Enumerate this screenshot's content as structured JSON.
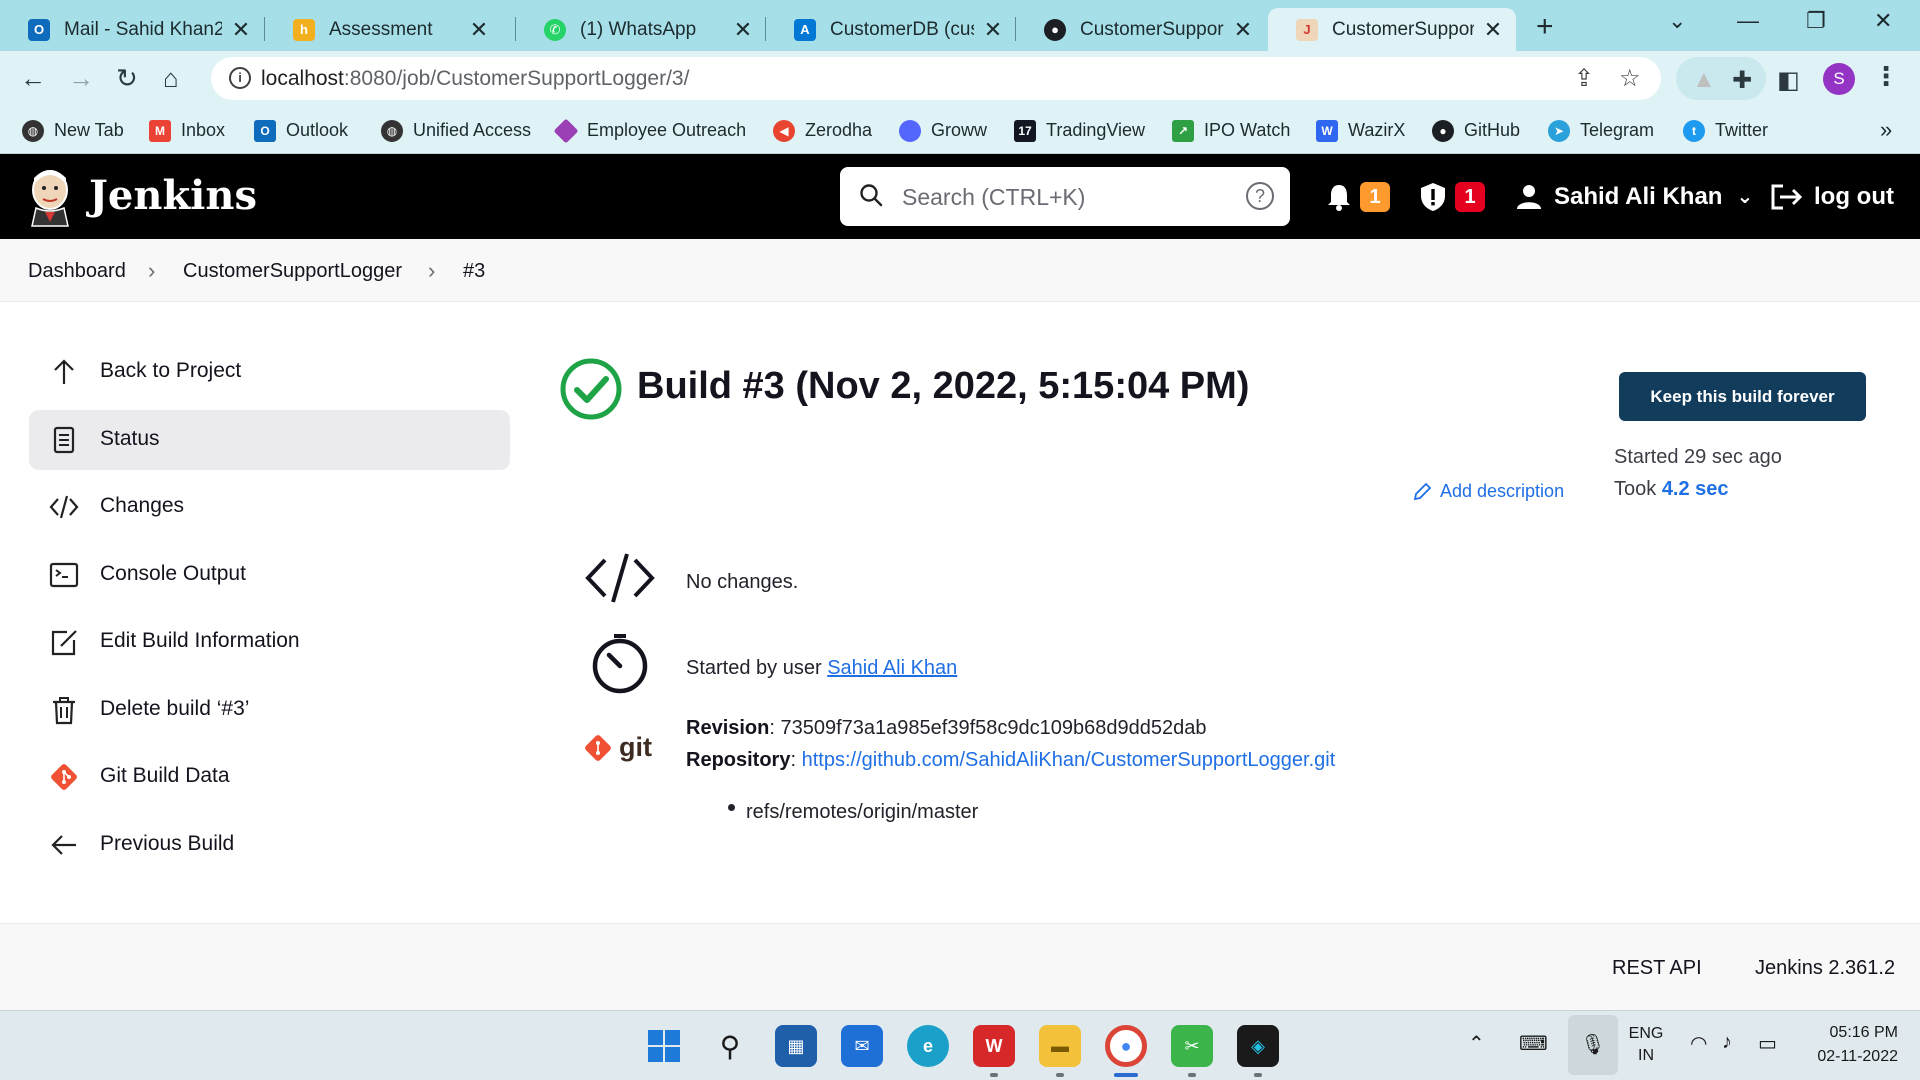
{
  "browser": {
    "tabs": [
      {
        "title": "Mail - Sahid Khan2",
        "icon": "outlook-icon",
        "color": "#0f6cbd"
      },
      {
        "title": "Assessment",
        "icon": "assessment-icon",
        "color": "#f2b01e"
      },
      {
        "title": "(1) WhatsApp",
        "icon": "whatsapp-icon",
        "color": "#25d366"
      },
      {
        "title": "CustomerDB (custo",
        "icon": "azure-icon",
        "color": "#0078d4"
      },
      {
        "title": "CustomerSupportLc",
        "icon": "github-icon",
        "color": "#1b1f23"
      },
      {
        "title": "CustomerSupportLc",
        "icon": "jenkins-icon",
        "color": "#d33833"
      }
    ],
    "url_scheme_host": "localhost",
    "url_rest": ":8080/job/CustomerSupportLogger/3/",
    "profile_initial": "S",
    "bookmarks": [
      {
        "label": "New Tab",
        "icon": "globe-icon",
        "color": "#333333"
      },
      {
        "label": "Inbox",
        "icon": "gmail-icon",
        "color": "#ea4335"
      },
      {
        "label": "Outlook",
        "icon": "outlook-icon",
        "color": "#0f6cbd"
      },
      {
        "label": "Unified Access",
        "icon": "globe-icon",
        "color": "#333333"
      },
      {
        "label": "Employee Outreach",
        "icon": "diamond-icon",
        "color": "#9b3fb5"
      },
      {
        "label": "Zerodha",
        "icon": "zerodha-icon",
        "color": "#e8442f"
      },
      {
        "label": "Groww",
        "icon": "groww-icon",
        "color": "#5367ff"
      },
      {
        "label": "TradingView",
        "icon": "tradingview-icon",
        "color": "#131722"
      },
      {
        "label": "IPO Watch",
        "icon": "chart-up-icon",
        "color": "#2ea043"
      },
      {
        "label": "WazirX",
        "icon": "wazirx-icon",
        "color": "#3067f0"
      },
      {
        "label": "GitHub",
        "icon": "github-icon",
        "color": "#1b1f23"
      },
      {
        "label": "Telegram",
        "icon": "telegram-icon",
        "color": "#2aa1da"
      },
      {
        "label": "Twitter",
        "icon": "twitter-icon",
        "color": "#1d9bf0"
      }
    ]
  },
  "jenkins": {
    "title": "Jenkins",
    "search_placeholder": "Search (CTRL+K)",
    "notifications_count": "1",
    "security_count": "1",
    "user_name": "Sahid Ali Khan",
    "logout_label": "log out",
    "breadcrumb": [
      "Dashboard",
      "CustomerSupportLogger",
      "#3"
    ],
    "side_panel": [
      {
        "label": "Back to Project",
        "icon": "arrow-up-icon",
        "active": false
      },
      {
        "label": "Status",
        "icon": "document-icon",
        "active": true
      },
      {
        "label": "Changes",
        "icon": "code-icon",
        "active": false
      },
      {
        "label": "Console Output",
        "icon": "terminal-icon",
        "active": false
      },
      {
        "label": "Edit Build Information",
        "icon": "edit-icon",
        "active": false
      },
      {
        "label": "Delete build ‘#3’",
        "icon": "trash-icon",
        "active": false
      },
      {
        "label": "Git Build Data",
        "icon": "git-icon",
        "active": false
      },
      {
        "label": "Previous Build",
        "icon": "arrow-left-icon",
        "active": false
      }
    ],
    "build": {
      "title": "Build #3 (Nov 2, 2022, 5:15:04 PM)",
      "status": "success",
      "keep_button": "Keep this build forever",
      "started": "Started 29 sec ago",
      "took_label": "Took",
      "took_value": "4.2 sec",
      "add_description": "Add description",
      "changes_text": "No changes.",
      "started_by_prefix": "Started by user",
      "started_by_user": "Sahid Ali Khan",
      "revision_label": "Revision",
      "revision": "73509f73a1a985ef39f58c9dc109b68d9dd52dab",
      "repository_label": "Repository",
      "repository": "https://github.com/SahidAliKhan/CustomerSupportLogger.git",
      "branch": "refs/remotes/origin/master"
    },
    "footer": {
      "rest_api": "REST API",
      "version": "Jenkins 2.361.2"
    },
    "accent_color": "#1f6fe5",
    "success_color": "#1ea446"
  },
  "taskbar": {
    "language_line1": "ENG",
    "language_line2": "IN",
    "time": "05:16 PM",
    "date": "02-11-2022"
  }
}
